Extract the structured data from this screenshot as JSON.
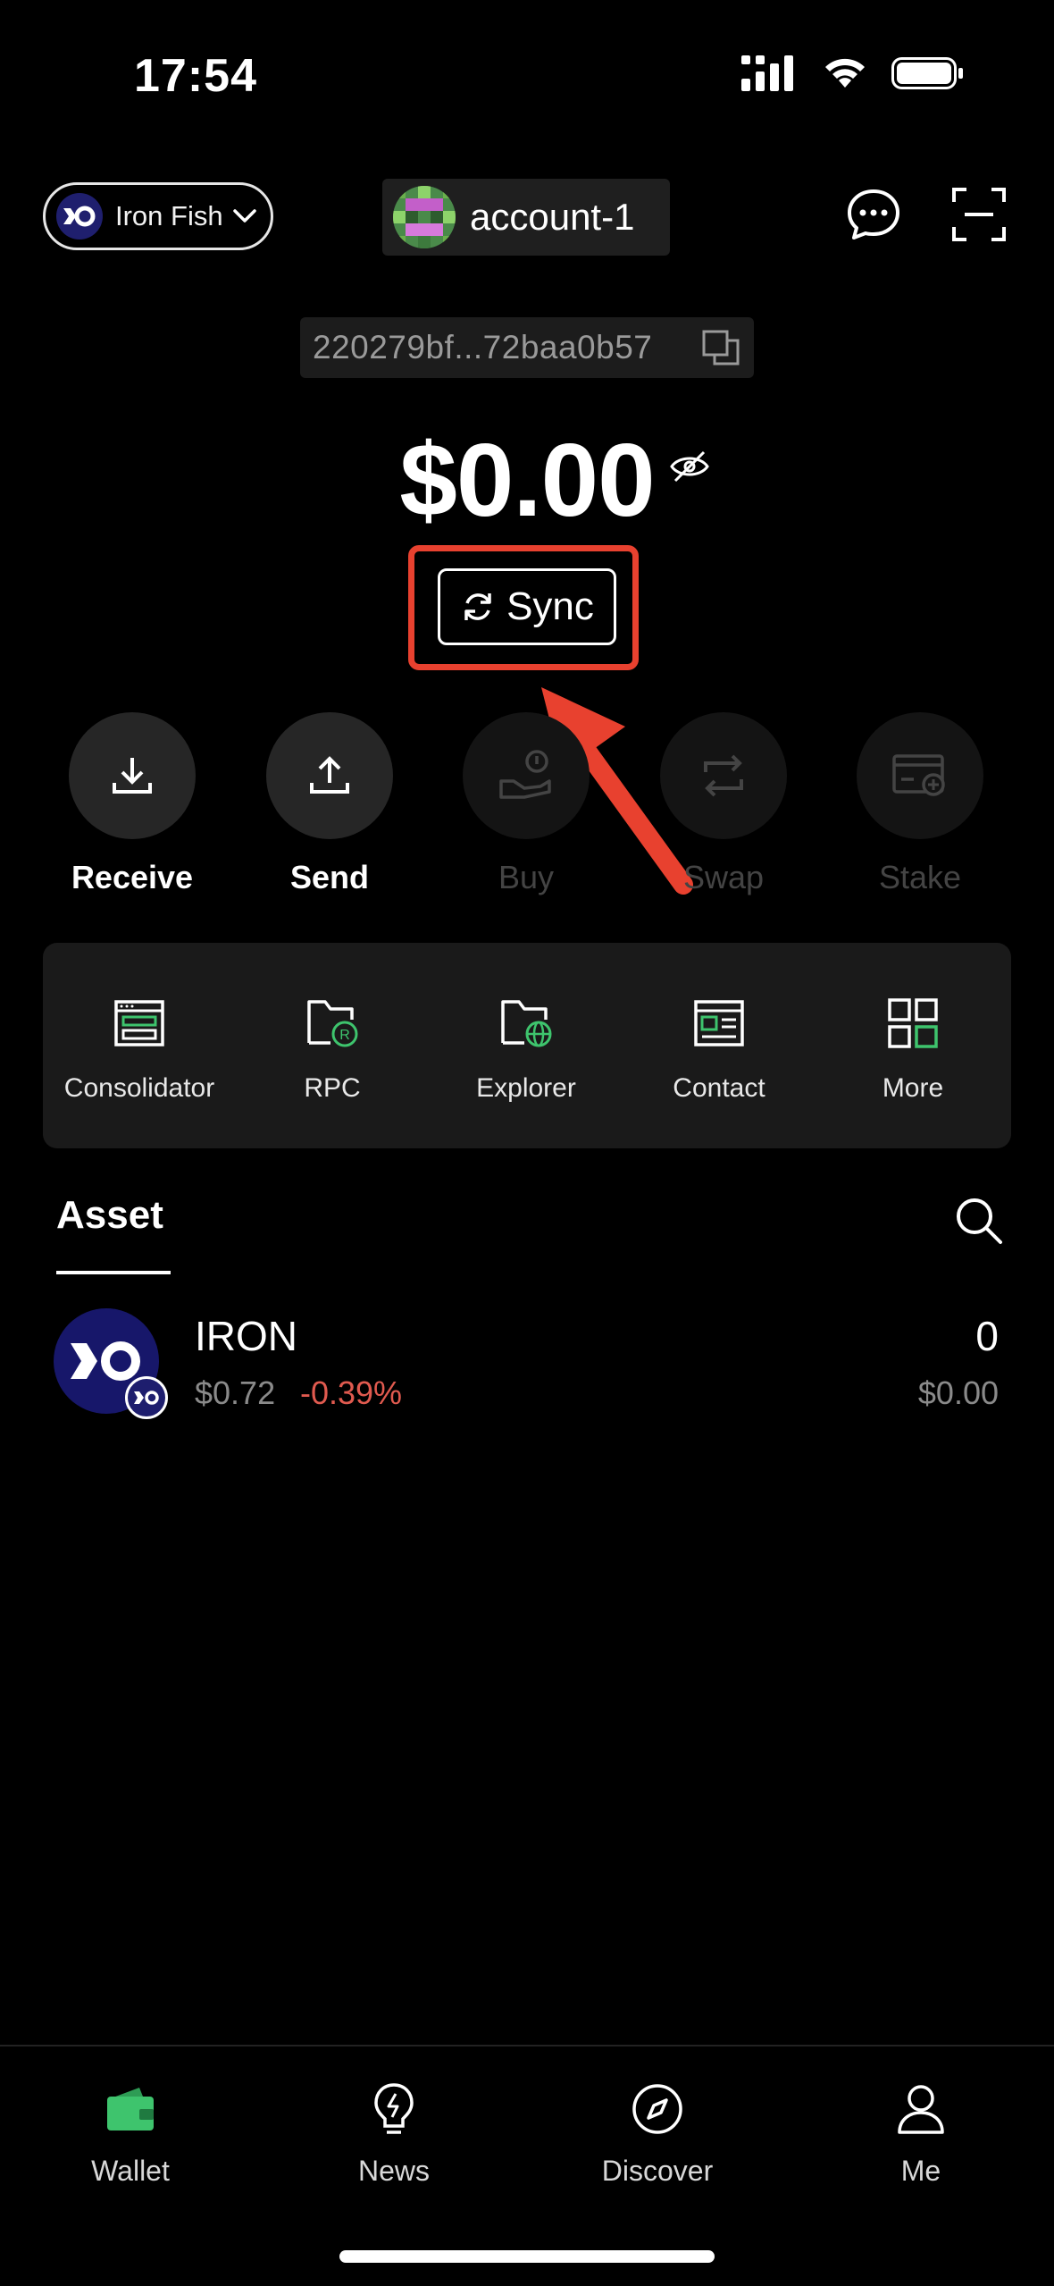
{
  "status_bar": {
    "time": "17:54"
  },
  "header": {
    "network_label": "Iron Fish",
    "account_label": "account-1"
  },
  "address": {
    "short": "220279bf...72baa0b57"
  },
  "balance": {
    "value": "$0.00"
  },
  "sync": {
    "label": "Sync"
  },
  "actions": [
    {
      "label": "Receive",
      "enabled": true
    },
    {
      "label": "Send",
      "enabled": true
    },
    {
      "label": "Buy",
      "enabled": false
    },
    {
      "label": "Swap",
      "enabled": false
    },
    {
      "label": "Stake",
      "enabled": false
    }
  ],
  "tools": [
    {
      "label": "Consolidator"
    },
    {
      "label": "RPC"
    },
    {
      "label": "Explorer"
    },
    {
      "label": "Contact"
    },
    {
      "label": "More"
    }
  ],
  "assets": {
    "tab_label": "Asset",
    "items": [
      {
        "symbol": "IRON",
        "price": "$0.72",
        "change": "-0.39%",
        "amount": "0",
        "value": "$0.00"
      }
    ]
  },
  "bottom_nav": [
    {
      "label": "Wallet",
      "active": true
    },
    {
      "label": "News",
      "active": false
    },
    {
      "label": "Discover",
      "active": false
    },
    {
      "label": "Me",
      "active": false
    }
  ],
  "colors": {
    "background": "#000000",
    "accent_green": "#3ec46d",
    "annotation_red": "#e8412f",
    "negative_red": "#e05a4f"
  }
}
